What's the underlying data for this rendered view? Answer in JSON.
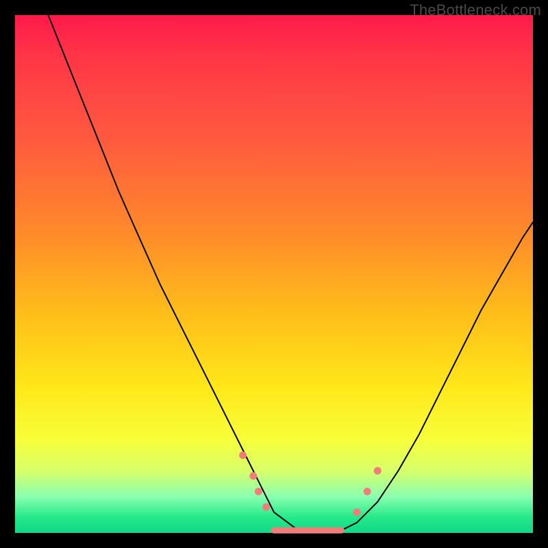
{
  "watermark": "TheBottleneck.com",
  "chart_data": {
    "type": "line",
    "title": "",
    "xlabel": "",
    "ylabel": "",
    "xlim": [
      0,
      100
    ],
    "ylim": [
      0,
      100
    ],
    "grid": false,
    "legend": false,
    "description": "V-shaped bottleneck curve overlaid on a red-to-green vertical gradient. The valley floor near y≈0 around x≈50–63 indicates balanced performance; higher y toward red indicates larger bottleneck.",
    "series": [
      {
        "name": "bottleneck-curve",
        "x": [
          0,
          4,
          8,
          12,
          16,
          20,
          24,
          28,
          32,
          36,
          40,
          44,
          47,
          50,
          54,
          58,
          62,
          66,
          70,
          74,
          78,
          82,
          86,
          90,
          94,
          98,
          100
        ],
        "y": [
          116,
          106,
          96,
          86,
          76,
          66,
          57,
          48,
          40,
          32,
          24,
          16,
          10,
          4,
          1,
          0,
          0,
          2,
          6,
          12,
          19,
          27,
          35,
          43,
          50,
          57,
          60
        ]
      }
    ],
    "markers": [
      {
        "x": 44.0,
        "y": 15.0
      },
      {
        "x": 46.0,
        "y": 11.0
      },
      {
        "x": 47.0,
        "y": 8.0
      },
      {
        "x": 48.5,
        "y": 5.0
      },
      {
        "x": 66.0,
        "y": 4.0
      },
      {
        "x": 68.0,
        "y": 8.0
      },
      {
        "x": 70.0,
        "y": 12.0
      }
    ],
    "flat_segment": {
      "x0": 50,
      "x1": 63,
      "y": 0.5
    }
  },
  "colors": {
    "gradient_top": "#ff1a4a",
    "gradient_bottom": "#12d888",
    "curve": "#000000",
    "marker": "#ee7e79",
    "frame": "#000000"
  }
}
